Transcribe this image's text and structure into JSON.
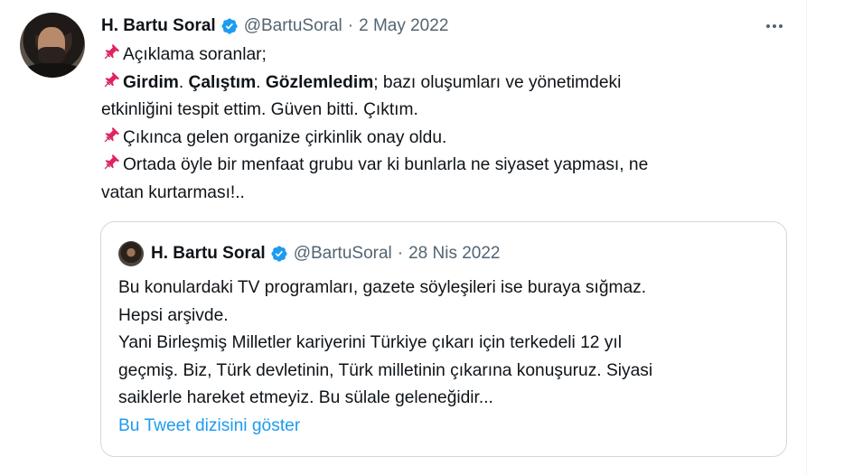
{
  "tweet": {
    "author_name": "H. Bartu Soral",
    "handle": "@BartuSoral",
    "date": "2 May 2022",
    "lines": {
      "l1": "Açıklama soranlar;",
      "l2_b1": "Girdim",
      "l2_b2": "Çalıştım",
      "l2_b3": "Gözlemledim",
      "l2_rest": "; bazı oluşumları ve yönetimdeki",
      "l3": "etkinliğini tespit ettim. Güven bitti. Çıktım.",
      "l4": "Çıkınca gelen organize çirkinlik onay oldu.",
      "l5": "Ortada öyle bir menfaat grubu var ki bunlarla ne siyaset yapması, ne",
      "l6": "vatan kurtarması!.."
    }
  },
  "quoted": {
    "author_name": "H. Bartu Soral",
    "handle": "@BartuSoral",
    "date": "28 Nis 2022",
    "lines": [
      "Bu konulardaki TV programları, gazete söyleşileri ise buraya sığmaz.",
      "Hepsi arşivde.",
      "Yani Birleşmiş Milletler kariyerini Türkiye çıkarı için terkedeli 12 yıl",
      "geçmiş. Biz, Türk devletinin, Türk milletinin çıkarına konuşuruz. Siyasi",
      "saiklerle hareket etmeyiz. Bu sülale geleneğidir..."
    ],
    "show_thread": "Bu Tweet dizisini göster"
  },
  "colors": {
    "accent": "#1d9bf0",
    "secondary_text": "#536471",
    "border": "#cfd9de"
  },
  "icons": {
    "verified": "verified-badge-icon",
    "more": "more-dots-icon",
    "pin": "pushpin-emoji-icon"
  }
}
